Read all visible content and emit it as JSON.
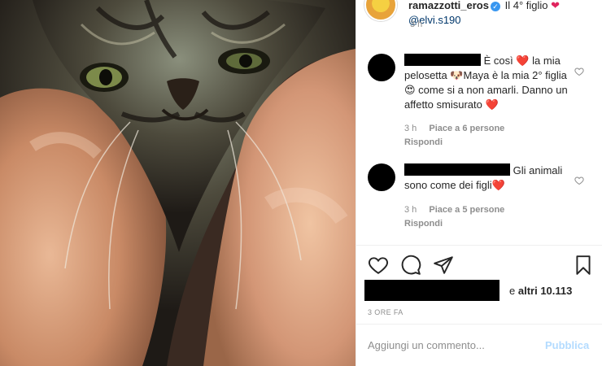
{
  "post": {
    "username": "ramazzotti_eros",
    "caption_text": "Il 4° figlio",
    "caption_mention": "@elvi.s190",
    "time": "3 h"
  },
  "comments": [
    {
      "text": "È così ❤️ la mia pelosetta 🐶Maya è la mia 2° figlia 😍 come si a non amarli. Danno un affetto smisurato ❤️",
      "time": "3 h",
      "likes": "Piace a 6 persone",
      "reply": "Rispondi"
    },
    {
      "text": "Gli animali sono come dei figli❤️",
      "time": "3 h",
      "likes": "Piace a 5 persone",
      "reply": "Rispondi"
    }
  ],
  "likes": {
    "prefix": "e",
    "count": "altri 10.113"
  },
  "post_age": "3 ORE FA",
  "comment_box": {
    "placeholder": "Aggiungi un commento...",
    "publish": "Pubblica"
  },
  "icons": {
    "like": "heart-icon",
    "comment": "comment-bubble-icon",
    "share": "paper-plane-icon",
    "save": "bookmark-icon",
    "verified": "verified-badge-icon"
  },
  "colors": {
    "heart": "#e0245e",
    "verified": "#3897f0",
    "publish_disabled": "#b3dbff",
    "muted": "#8e8e8e"
  }
}
